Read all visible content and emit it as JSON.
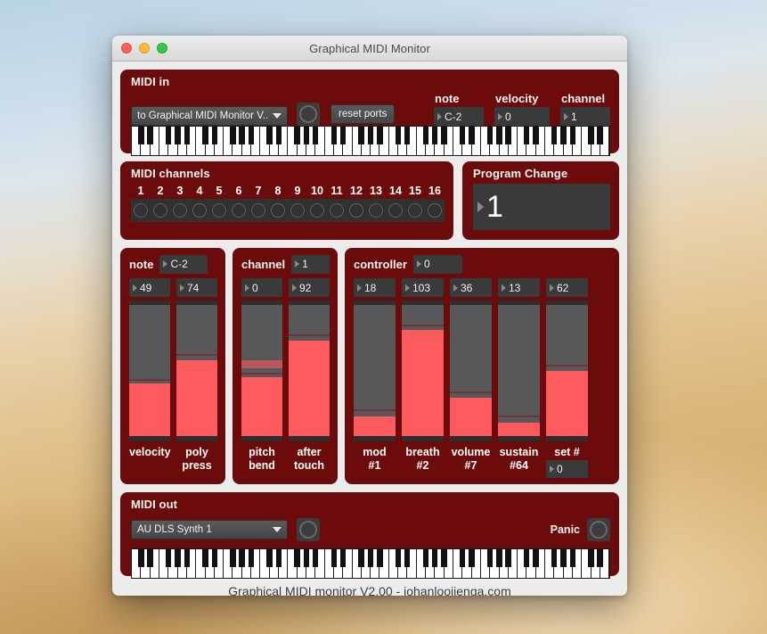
{
  "window": {
    "title": "Graphical MIDI Monitor",
    "traffic_lights": [
      "close-button",
      "minimize-button",
      "zoom-button"
    ],
    "footer": "Graphical MIDI monitor V2.00 - johanlooijenga.com"
  },
  "theme": {
    "panel_red": "#6c0b0b",
    "readout_dark": "#3a3a3a",
    "meter_track": "#585858",
    "meter_fill": "#fd5a5e",
    "meter_cap": "#2e2e2e",
    "window_chrome": "#ececec"
  },
  "midi_in": {
    "label": "MIDI in",
    "port_select": "to Graphical MIDI Monitor V...",
    "activity_led": "off",
    "reset_button": "reset ports",
    "fields": [
      {
        "label": "note",
        "value": "C-2"
      },
      {
        "label": "velocity",
        "value": "0"
      },
      {
        "label": "channel",
        "value": "1"
      }
    ],
    "keyboard_keys": 52
  },
  "midi_channels": {
    "label": "MIDI channels",
    "numbers": [
      "1",
      "2",
      "3",
      "4",
      "5",
      "6",
      "7",
      "8",
      "9",
      "10",
      "11",
      "12",
      "13",
      "14",
      "15",
      "16"
    ],
    "active": []
  },
  "program_change": {
    "label": "Program Change",
    "value": "1"
  },
  "note_panel": {
    "label": "note",
    "value": "C-2",
    "meters": [
      {
        "name": "velocity",
        "label_line1": "velocity",
        "label_line2": "",
        "value": "49",
        "fill_pct": 40,
        "peak_pct": 42
      },
      {
        "name": "poly-press",
        "label_line1": "poly",
        "label_line2": "press",
        "value": "74",
        "fill_pct": 58,
        "peak_pct": 61
      }
    ]
  },
  "channel_panel": {
    "label": "channel",
    "value": "1",
    "meters": [
      {
        "name": "pitch-bend",
        "label_line1": "pitch",
        "label_line2": "bend",
        "value": "0",
        "fill_pct": 45,
        "peak_pct": 47,
        "ghost_lo_pct": 52,
        "ghost_hi_pct": 58
      },
      {
        "name": "after-touch",
        "label_line1": "after",
        "label_line2": "touch",
        "value": "92",
        "fill_pct": 73,
        "peak_pct": 76
      }
    ]
  },
  "controller_panel": {
    "label": "controller",
    "value": "0",
    "meters": [
      {
        "name": "mod",
        "label_line1": "mod",
        "label_line2": "#1",
        "value": "18",
        "fill_pct": 15,
        "peak_pct": 19
      },
      {
        "name": "breath",
        "label_line1": "breath",
        "label_line2": "#2",
        "value": "103",
        "fill_pct": 81,
        "peak_pct": 84
      },
      {
        "name": "volume",
        "label_line1": "volume",
        "label_line2": "#7",
        "value": "36",
        "fill_pct": 29,
        "peak_pct": 33
      },
      {
        "name": "sustain",
        "label_line1": "sustain",
        "label_line2": "#64",
        "value": "13",
        "fill_pct": 10,
        "peak_pct": 14
      },
      {
        "name": "set-number",
        "label_line1": "set #",
        "label_line2": "",
        "value": "62",
        "fill_pct": 50,
        "peak_pct": 53,
        "extra_field": "0"
      }
    ]
  },
  "midi_out": {
    "label": "MIDI out",
    "port_select": "AU DLS Synth 1",
    "activity_led": "off",
    "panic_label": "Panic",
    "keyboard_keys": 52
  }
}
